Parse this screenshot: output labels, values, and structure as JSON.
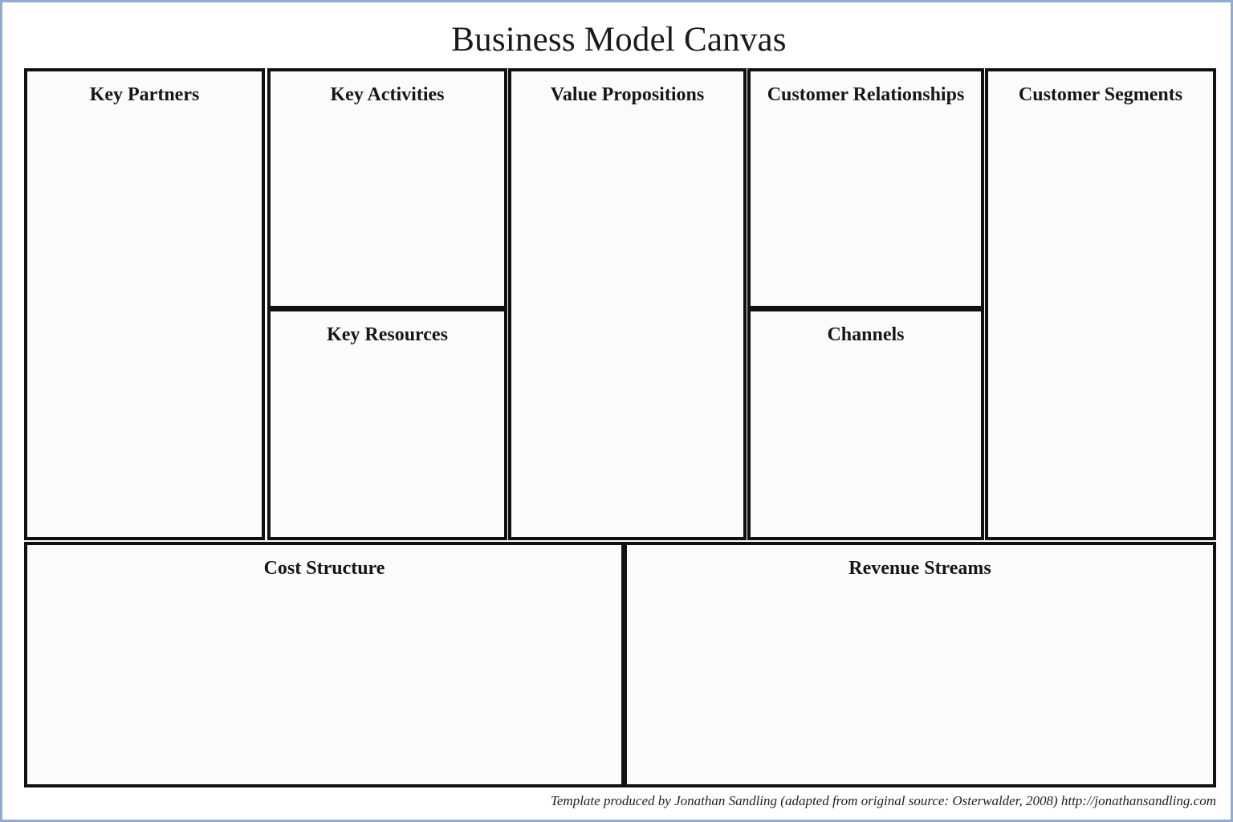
{
  "document": {
    "title": "Business Model Canvas"
  },
  "canvas": {
    "blocks": [
      {
        "id": "key-partners",
        "title": "Key Partners"
      },
      {
        "id": "key-activities",
        "title": "Key Activities"
      },
      {
        "id": "key-resources",
        "title": "Key Resources"
      },
      {
        "id": "value-propositions",
        "title": "Value Propositions"
      },
      {
        "id": "customer-relationships",
        "title": "Customer Relationships"
      },
      {
        "id": "channels",
        "title": "Channels"
      },
      {
        "id": "customer-segments",
        "title": "Customer Segments"
      },
      {
        "id": "cost-structure",
        "title": "Cost Structure"
      },
      {
        "id": "revenue-streams",
        "title": "Revenue Streams"
      }
    ]
  },
  "footer": {
    "credit": "Template produced by Jonathan Sandling  (adapted from original source: Osterwalder, 2008)  http://jonathansandling.com"
  },
  "colors": {
    "page_border": "#8fabd4",
    "cell_border": "#111111",
    "cell_fill": "#fbfbfb",
    "text": "#161616",
    "background": "#ffffff"
  }
}
